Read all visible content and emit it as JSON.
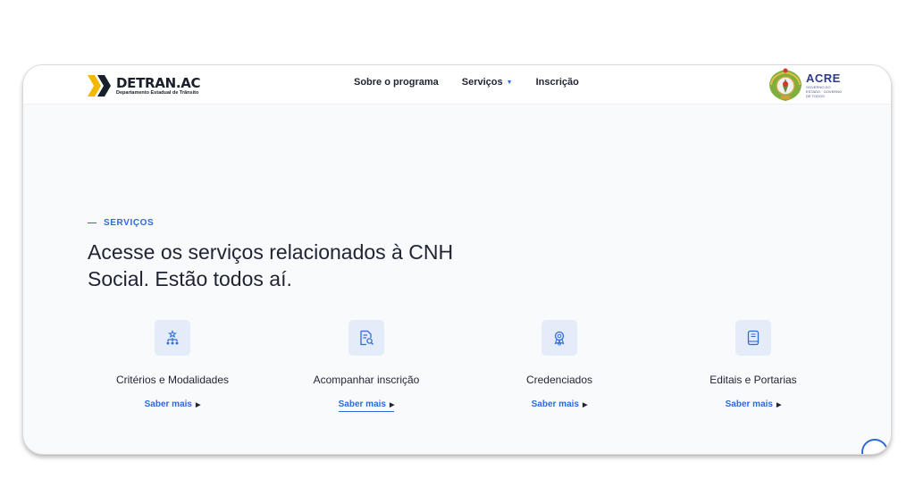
{
  "header": {
    "logo_title": "DETRAN.AC",
    "logo_subtitle": "Departamento Estadual de Trânsito",
    "nav": [
      {
        "label": "Sobre o programa",
        "has_dropdown": false
      },
      {
        "label": "Serviços",
        "has_dropdown": true
      },
      {
        "label": "Inscrição",
        "has_dropdown": false
      }
    ],
    "gov_title": "ACRE",
    "gov_subtitle": "GOVERNO DO ESTADO · GOVERNO DE TODOS"
  },
  "section": {
    "tag": "SERVIÇOS",
    "headline": "Acesse os serviços relacionados à CNH Social. Estão todos aí."
  },
  "cards": [
    {
      "title": "Critérios e Modalidades",
      "link": "Saber mais",
      "icon": "hierarchy-icon"
    },
    {
      "title": "Acompanhar inscrição",
      "link": "Saber mais",
      "icon": "document-search-icon"
    },
    {
      "title": "Credenciados",
      "link": "Saber mais",
      "icon": "award-badge-icon"
    },
    {
      "title": "Editais e Portarias",
      "link": "Saber mais",
      "icon": "book-icon"
    }
  ],
  "colors": {
    "accent": "#2e6bd6",
    "text": "#1f2433",
    "logo_yellow": "#f5b800",
    "icon_bg": "#e4ecf9"
  }
}
